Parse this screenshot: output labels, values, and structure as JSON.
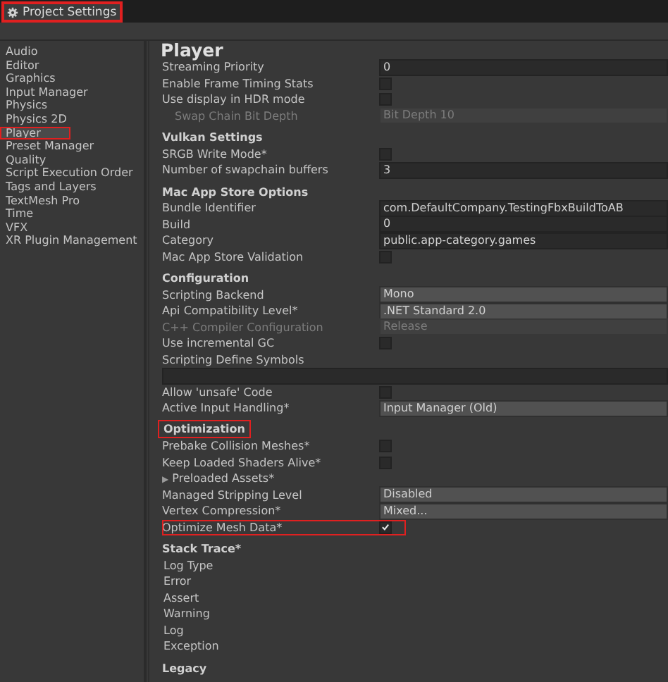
{
  "window": {
    "tab": {
      "title": "Project Settings",
      "highlighted": true
    }
  },
  "sidebar": {
    "items": [
      {
        "label": "Audio",
        "selected": false,
        "highlighted": false
      },
      {
        "label": "Editor",
        "selected": false,
        "highlighted": false
      },
      {
        "label": "Graphics",
        "selected": false,
        "highlighted": false
      },
      {
        "label": "Input Manager",
        "selected": false,
        "highlighted": false
      },
      {
        "label": "Physics",
        "selected": false,
        "highlighted": false
      },
      {
        "label": "Physics 2D",
        "selected": false,
        "highlighted": false
      },
      {
        "label": "Player",
        "selected": true,
        "highlighted": true
      },
      {
        "label": "Preset Manager",
        "selected": false,
        "highlighted": false
      },
      {
        "label": "Quality",
        "selected": false,
        "highlighted": false
      },
      {
        "label": "Script Execution Order",
        "selected": false,
        "highlighted": false
      },
      {
        "label": "Tags and Layers",
        "selected": false,
        "highlighted": false
      },
      {
        "label": "TextMesh Pro",
        "selected": false,
        "highlighted": false
      },
      {
        "label": "Time",
        "selected": false,
        "highlighted": false
      },
      {
        "label": "VFX",
        "selected": false,
        "highlighted": false
      },
      {
        "label": "XR Plugin Management",
        "selected": false,
        "highlighted": false
      }
    ]
  },
  "panel": {
    "title": "Player",
    "rows": [
      {
        "kind": "field",
        "label": "Streaming Priority",
        "value": "0"
      },
      {
        "kind": "checkbox",
        "label": "Enable Frame Timing Stats",
        "checked": false
      },
      {
        "kind": "checkbox",
        "label": "Use display in HDR mode",
        "checked": false
      },
      {
        "kind": "dropdown",
        "label": "Swap Chain Bit Depth",
        "value": "Bit Depth 10",
        "disabled": true,
        "indented": true
      },
      {
        "kind": "header",
        "label": "Vulkan Settings"
      },
      {
        "kind": "checkbox",
        "label": "SRGB Write Mode*",
        "checked": false
      },
      {
        "kind": "field",
        "label": "Number of swapchain buffers",
        "value": "3"
      },
      {
        "kind": "header",
        "label": "Mac App Store Options"
      },
      {
        "kind": "field",
        "label": "Bundle Identifier",
        "value": "com.DefaultCompany.TestingFbxBuildToAB"
      },
      {
        "kind": "field",
        "label": "Build",
        "value": "0"
      },
      {
        "kind": "field",
        "label": "Category",
        "value": "public.app-category.games"
      },
      {
        "kind": "checkbox",
        "label": "Mac App Store Validation",
        "checked": false
      },
      {
        "kind": "header",
        "label": "Configuration"
      },
      {
        "kind": "dropdown",
        "label": "Scripting Backend",
        "value": "Mono"
      },
      {
        "kind": "dropdown",
        "label": "Api Compatibility Level*",
        "value": ".NET Standard 2.0"
      },
      {
        "kind": "dropdown",
        "label": "C++ Compiler Configuration",
        "value": "Release",
        "disabled": true
      },
      {
        "kind": "checkbox",
        "label": "Use incremental GC",
        "checked": false
      },
      {
        "kind": "label",
        "label": "Scripting Define Symbols"
      },
      {
        "kind": "widefield"
      },
      {
        "kind": "checkbox",
        "label": "Allow 'unsafe' Code",
        "checked": false
      },
      {
        "kind": "dropdown",
        "label": "Active Input Handling*",
        "value": "Input Manager (Old)"
      },
      {
        "kind": "header",
        "label": "Optimization",
        "highlighted": true
      },
      {
        "kind": "checkbox",
        "label": "Prebake Collision Meshes*",
        "checked": false
      },
      {
        "kind": "checkbox",
        "label": "Keep Loaded Shaders Alive*",
        "checked": false
      },
      {
        "kind": "foldout",
        "label": "Preloaded Assets*",
        "glyph": "▶",
        "expanded": false
      },
      {
        "kind": "dropdown",
        "label": "Managed Stripping Level",
        "value": "Disabled"
      },
      {
        "kind": "dropdown",
        "label": "Vertex Compression*",
        "value": "Mixed..."
      },
      {
        "kind": "checkbox",
        "label": "Optimize Mesh Data*",
        "checked": true,
        "highlighted": true
      },
      {
        "kind": "header",
        "label": "Stack Trace*"
      },
      {
        "kind": "sublabel",
        "label": "Log Type"
      },
      {
        "kind": "sublabel",
        "label": "Error"
      },
      {
        "kind": "sublabel",
        "label": "Assert"
      },
      {
        "kind": "sublabel",
        "label": "Warning"
      },
      {
        "kind": "sublabel",
        "label": "Log"
      },
      {
        "kind": "sublabel",
        "label": "Exception"
      },
      {
        "kind": "header",
        "label": "Legacy"
      }
    ]
  }
}
